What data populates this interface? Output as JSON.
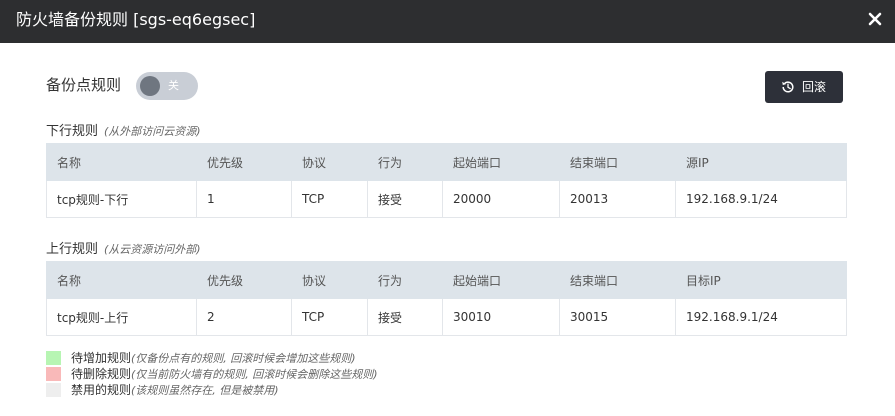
{
  "dialog": {
    "title": "防火墙备份规则 [sgs-eq6egsec]"
  },
  "backup": {
    "label": "备份点规则",
    "toggle_text": "关"
  },
  "rollback": {
    "label": "回滚"
  },
  "inbound": {
    "title": "下行规则",
    "subtitle": "(从外部访问云资源)",
    "headers": [
      "名称",
      "优先级",
      "协议",
      "行为",
      "起始端口",
      "结束端口",
      "源IP"
    ],
    "rows": [
      [
        "tcp规则-下行",
        "1",
        "TCP",
        "接受",
        "20000",
        "20013",
        "192.168.9.1/24"
      ]
    ]
  },
  "outbound": {
    "title": "上行规则",
    "subtitle": "(从云资源访问外部)",
    "headers": [
      "名称",
      "优先级",
      "协议",
      "行为",
      "起始端口",
      "结束端口",
      "目标IP"
    ],
    "rows": [
      [
        "tcp规则-上行",
        "2",
        "TCP",
        "接受",
        "30010",
        "30015",
        "192.168.9.1/24"
      ]
    ]
  },
  "legend": [
    {
      "label": "待增加规则",
      "note": "(仅备份点有的规则, 回滚时候会增加这些规则)",
      "color": "#b7f5b3"
    },
    {
      "label": "待删除规则",
      "note": "(仅当前防火墙有的规则, 回滚时候会删除这些规则)",
      "color": "#f9b9b9"
    },
    {
      "label": "禁用的规则",
      "note": "(该规则虽然存在, 但是被禁用)",
      "color": "#eeeeee"
    }
  ],
  "colors": {
    "titlebar": "#2d2e30",
    "button": "#2d3039",
    "table_header": "#dde4ea",
    "toggle_off": "#c9ced6"
  },
  "icons": {
    "close": "close-icon",
    "rollback": "history-icon"
  }
}
